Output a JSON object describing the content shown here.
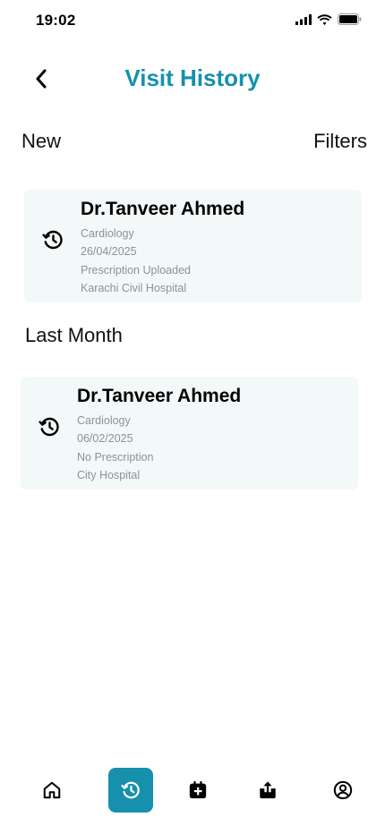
{
  "status": {
    "time": "19:02"
  },
  "header": {
    "title": "Visit History"
  },
  "sections": {
    "new_label": "New",
    "filters_label": "Filters",
    "last_month_label": "Last Month"
  },
  "visits": [
    {
      "doctor": "Dr.Tanveer Ahmed",
      "specialty": "Cardiology",
      "date": "26/04/2025",
      "prescription": "Prescription Uploaded",
      "hospital": "Karachi Civil Hospital"
    },
    {
      "doctor": "Dr.Tanveer Ahmed",
      "specialty": "Cardiology",
      "date": "06/02/2025",
      "prescription": "No Prescription",
      "hospital": "City Hospital"
    }
  ],
  "nav": {
    "items": [
      "home-icon",
      "history-icon",
      "calendar-add-icon",
      "share-icon",
      "profile-icon"
    ],
    "active": "history-icon"
  },
  "colors": {
    "accent": "#1690ad",
    "card_bg": "#f3f8f8",
    "meta_text": "#8d9394"
  }
}
